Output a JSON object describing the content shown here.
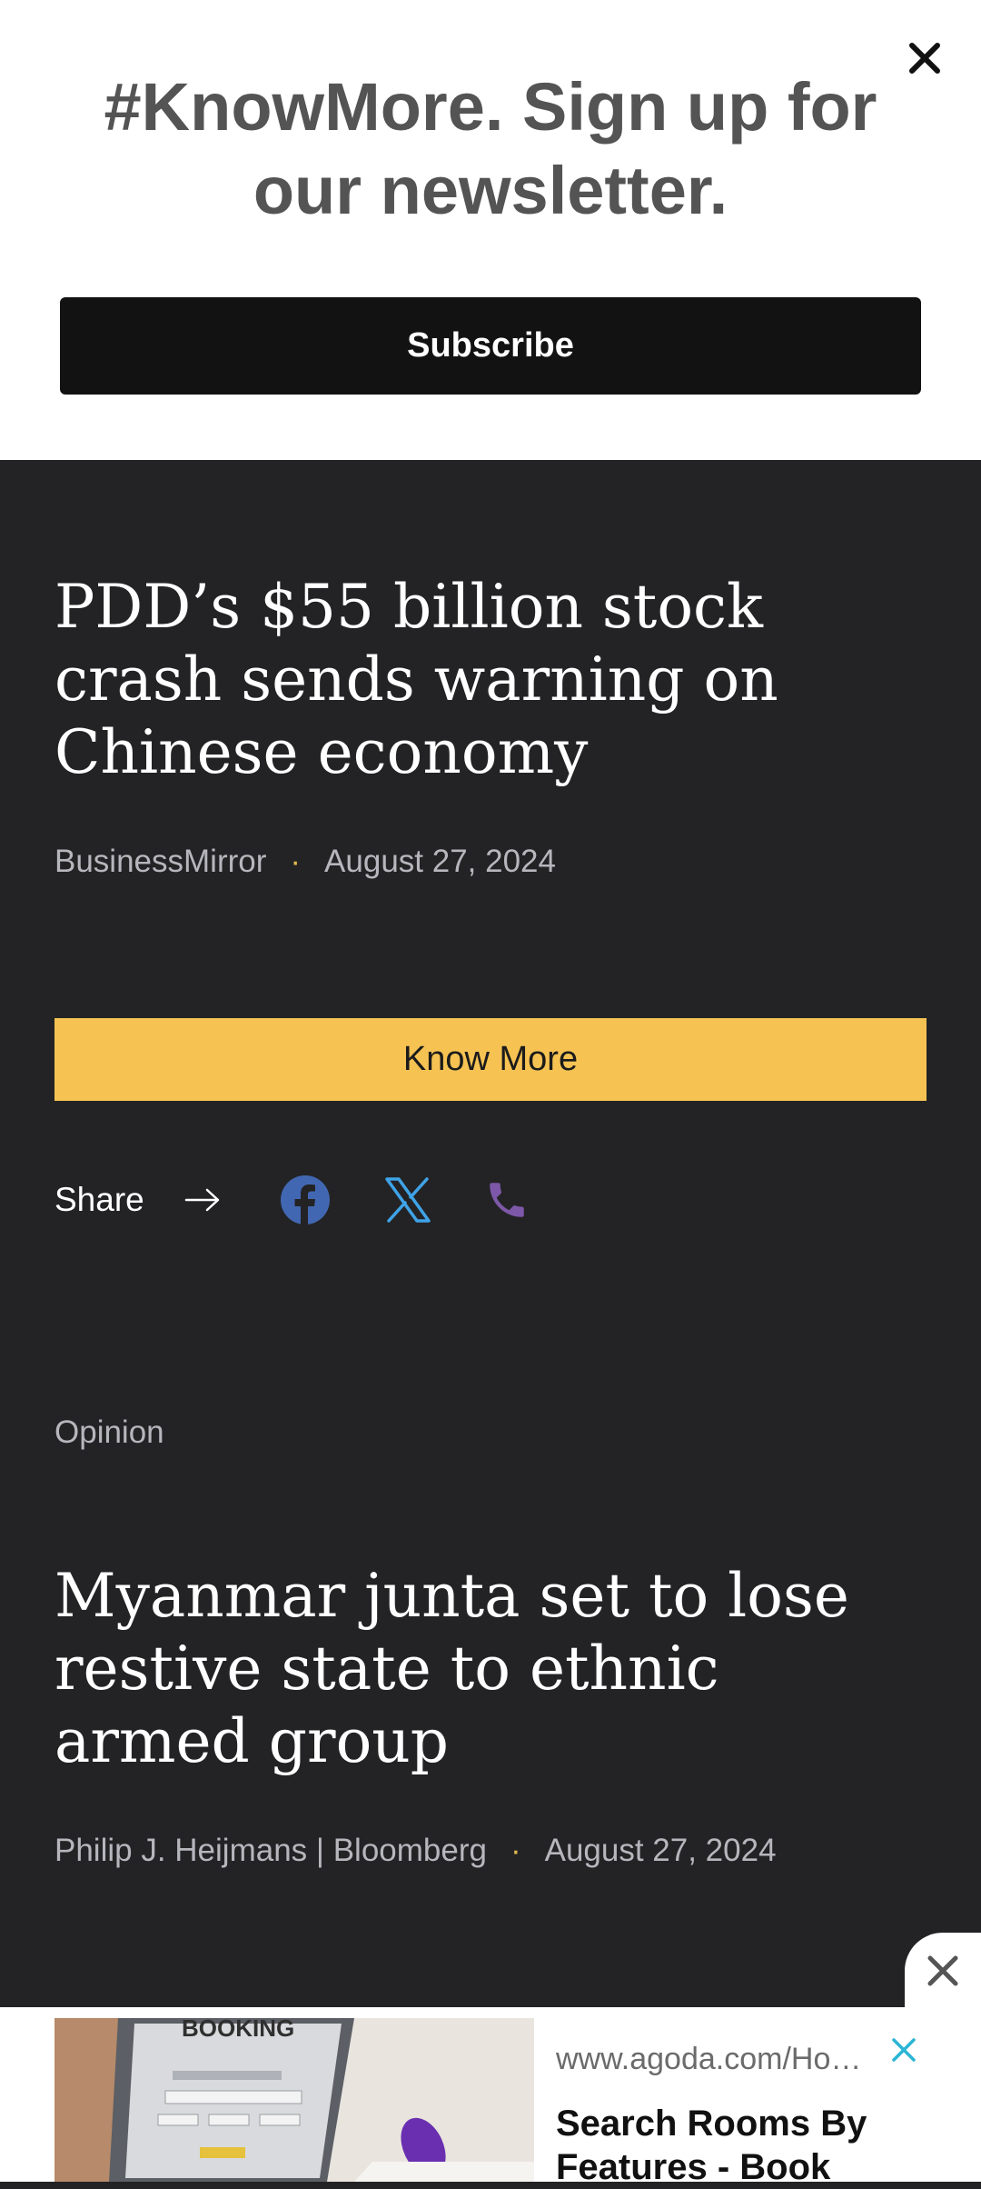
{
  "newsletter": {
    "title": "#KnowMore. Sign up for our newsletter.",
    "subscribe_label": "Subscribe",
    "close_icon": "close-icon"
  },
  "article1": {
    "headline": "PDD’s $55 billion stock crash sends warning on Chinese economy",
    "source": "BusinessMirror",
    "separator": "·",
    "date": "August 27, 2024",
    "know_more_label": "Know More"
  },
  "share": {
    "label": "Share",
    "icons": [
      "arrow-right-icon",
      "facebook-icon",
      "x-twitter-icon",
      "phone-icon"
    ],
    "colors": {
      "facebook": "#4267b2",
      "x": "#3fa3e8",
      "phone": "#7d58a8"
    }
  },
  "article2": {
    "category": "Opinion",
    "headline": "Myanmar junta set to lose restive state to ethnic armed group",
    "source": "Philip J. Heijmans | Bloomberg",
    "separator": "·",
    "date": "August 27, 2024"
  },
  "ad": {
    "image_text": "BOOKING",
    "url": "www.agoda.com/Ho…",
    "title": "Search Rooms By Features - Book",
    "close_color": "#2bb5d6"
  },
  "colors": {
    "background": "#232325",
    "accent": "#f6c353",
    "meta_dot": "#e0b84d"
  }
}
